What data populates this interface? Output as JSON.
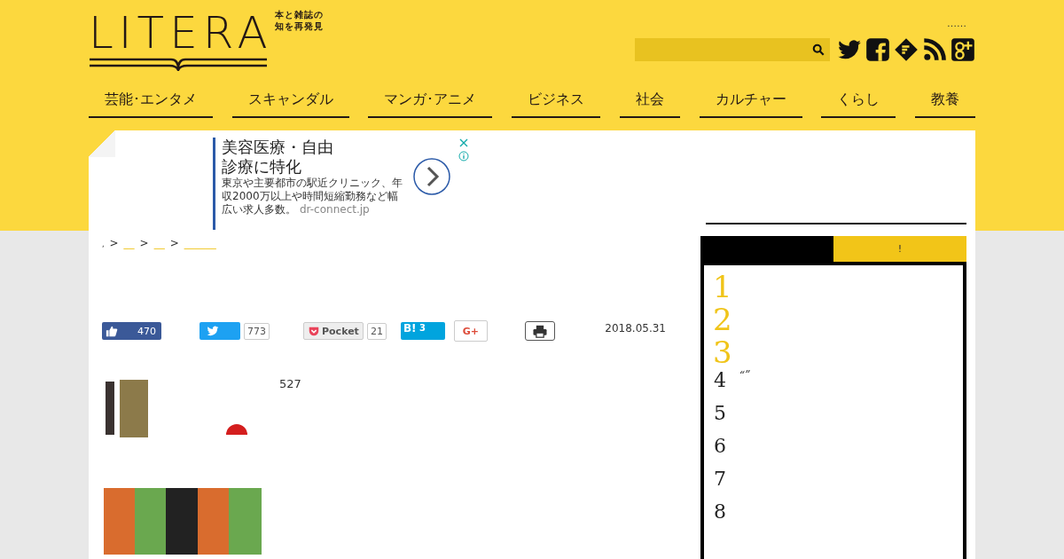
{
  "logo": {
    "text": "LITERA",
    "tagline": [
      "本と雑誌の",
      "知を再発見"
    ]
  },
  "header_dots": "……",
  "nav": [
    {
      "label": "芸能･エンタメ",
      "selected": false
    },
    {
      "label": "スキャンダル",
      "selected": false
    },
    {
      "label": "マンガ･アニメ",
      "selected": false
    },
    {
      "label": "ビジネス",
      "selected": false
    },
    {
      "label": "社会",
      "selected": false
    },
    {
      "label": "カルチャー",
      "selected": false
    },
    {
      "label": "くらし",
      "selected": false
    },
    {
      "label": "教養",
      "selected": false
    }
  ],
  "ad": {
    "headline": "美容医療・自由診療に特化",
    "body": "東京や主要都市の駅近クリニック、年収2000万以上や時間短縮勤務など幅広い求人多数。",
    "domain": "dr-connect.jp"
  },
  "breadcrumb_separator": ">",
  "breadcrumb": [
    {
      "kind": "text",
      "label": ","
    },
    {
      "kind": "link",
      "label": "__"
    },
    {
      "kind": "link",
      "label": "__"
    },
    {
      "kind": "link",
      "label": "______"
    }
  ],
  "share": {
    "like": "470",
    "tweet": "773",
    "pocket_label": "Pocket",
    "pocket": "21",
    "hatena_label": "B!",
    "hatena": "3",
    "gplus_label": "G+"
  },
  "date": "2018.05.31",
  "body_text": "527",
  "sidebar": {
    "tabs": [
      {
        "selected": true
      },
      {
        "label": "!",
        "selected": false
      }
    ],
    "ranking": [
      {
        "rank": "1",
        "top": true
      },
      {
        "rank": "2",
        "top": true
      },
      {
        "rank": "3",
        "top": true
      },
      {
        "rank": "4",
        "top": false,
        "title": "“”"
      },
      {
        "rank": "5",
        "top": false
      },
      {
        "rank": "6",
        "top": false
      },
      {
        "rank": "7",
        "top": false
      },
      {
        "rank": "8",
        "top": false
      }
    ]
  }
}
